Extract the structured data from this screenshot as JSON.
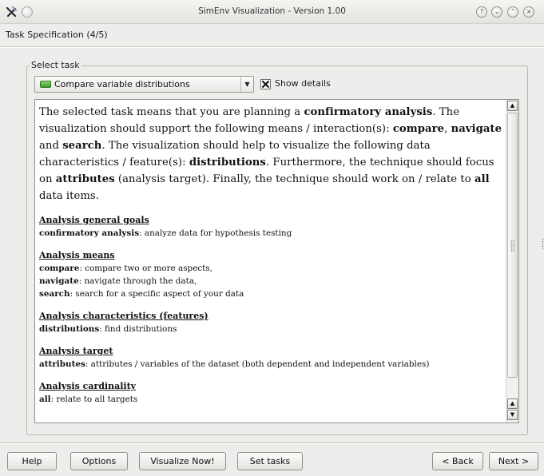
{
  "window": {
    "title": "SimEnv Visualization - Version 1.00",
    "icons": [
      "app-icon",
      "window-menu-icon",
      "help-icon",
      "minimize-icon",
      "maximize-icon",
      "close-icon"
    ],
    "help_glyph": "?",
    "minimize_glyph": "⌄",
    "maximize_glyph": "⌃",
    "close_glyph": "×"
  },
  "page": {
    "title": "Task Specification (4/5)"
  },
  "select_task": {
    "group_label": "Select task",
    "combo_value": "Compare variable distributions",
    "combo_arrow": "▼",
    "show_details_label": "Show details",
    "show_details_checked": true
  },
  "details": {
    "summary": [
      {
        "t": "The selected task means that you are planning a ",
        "b": false
      },
      {
        "t": "confirmatory analysis",
        "b": true
      },
      {
        "t": ". The visualization should support the following means / interaction(s): ",
        "b": false
      },
      {
        "t": "compare",
        "b": true
      },
      {
        "t": ", ",
        "b": false
      },
      {
        "t": "navigate",
        "b": true
      },
      {
        "t": " and ",
        "b": false
      },
      {
        "t": "search",
        "b": true
      },
      {
        "t": ". The visualization should help to visualize the following data characteristics / feature(s): ",
        "b": false
      },
      {
        "t": "distributions",
        "b": true
      },
      {
        "t": ". Furthermore, the technique should focus on ",
        "b": false
      },
      {
        "t": "attributes",
        "b": true
      },
      {
        "t": " (analysis target). Finally, the technique should work on / relate to ",
        "b": false
      },
      {
        "t": "all",
        "b": true
      },
      {
        "t": " data items.",
        "b": false
      }
    ],
    "sections": [
      {
        "heading": "Analysis general goals",
        "lines": [
          {
            "term": "confirmatory analysis",
            "text": ": analyze data for hypothesis testing"
          }
        ]
      },
      {
        "heading": "Analysis means",
        "lines": [
          {
            "term": "compare",
            "text": ": compare two or more aspects,"
          },
          {
            "term": "navigate",
            "text": ": navigate through the data,"
          },
          {
            "term": "search",
            "text": ": search for a specific aspect of your data"
          }
        ]
      },
      {
        "heading": "Analysis characteristics (features)",
        "lines": [
          {
            "term": "distributions",
            "text": ": find distributions"
          }
        ]
      },
      {
        "heading": "Analysis target",
        "lines": [
          {
            "term": "attributes",
            "text": ": attributes / variables of the dataset (both dependent and independent variables)"
          }
        ]
      },
      {
        "heading": "Analysis cardinality",
        "lines": [
          {
            "term": "all",
            "text": ": relate to all targets"
          }
        ]
      }
    ],
    "scroll_up_glyph": "▲",
    "scroll_down_glyph": "▼"
  },
  "buttons": {
    "help": "Help",
    "options": "Options",
    "visualize_now": "Visualize Now!",
    "set_tasks": "Set tasks",
    "back": "< Back",
    "next": "Next >"
  }
}
